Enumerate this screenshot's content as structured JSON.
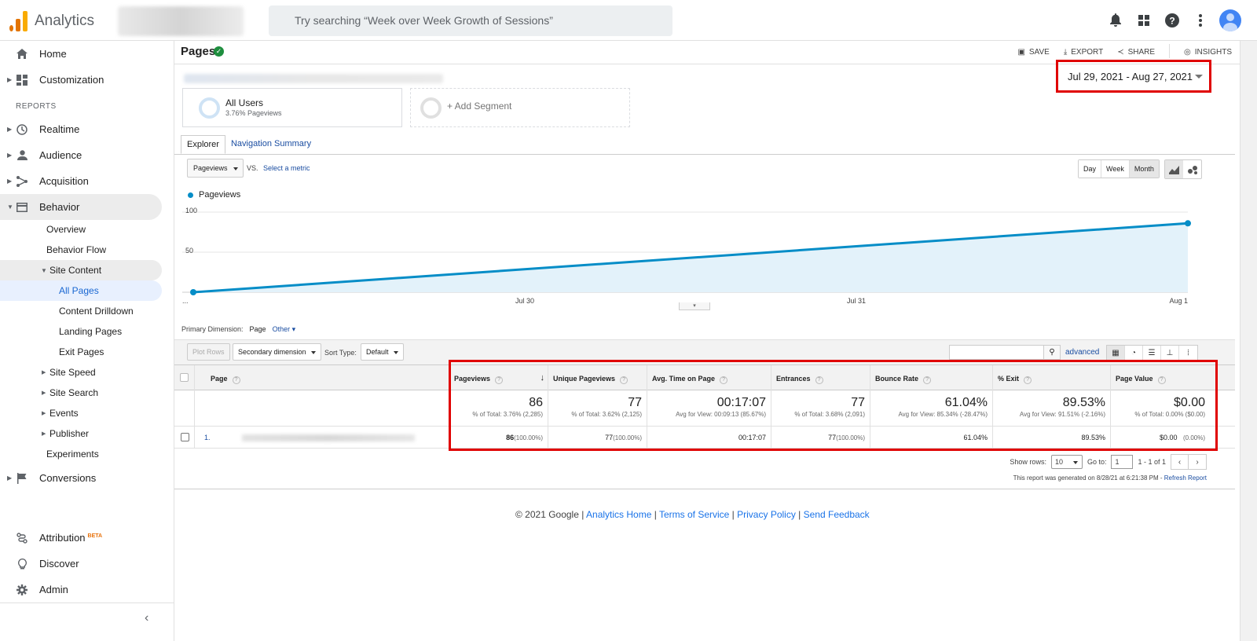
{
  "app": {
    "name": "Analytics"
  },
  "search": {
    "placeholder": "Try searching “Week over Week Growth of Sessions”"
  },
  "sidebar": {
    "home": "Home",
    "customization": "Customization",
    "reports_label": "REPORTS",
    "realtime": "Realtime",
    "audience": "Audience",
    "acquisition": "Acquisition",
    "behavior": "Behavior",
    "behavior_items": {
      "overview": "Overview",
      "behavior_flow": "Behavior Flow",
      "site_content": "Site Content",
      "all_pages": "All Pages",
      "content_drilldown": "Content Drilldown",
      "landing_pages": "Landing Pages",
      "exit_pages": "Exit Pages",
      "site_speed": "Site Speed",
      "site_search": "Site Search",
      "events": "Events",
      "publisher": "Publisher",
      "experiments": "Experiments"
    },
    "conversions": "Conversions",
    "attribution": "Attribution",
    "attribution_badge": "BETA",
    "discover": "Discover",
    "admin": "Admin"
  },
  "page": {
    "title": "Pages",
    "actions": {
      "save": "SAVE",
      "export": "EXPORT",
      "share": "SHARE",
      "insights": "INSIGHTS"
    },
    "date_range": "Jul 29, 2021 - Aug 27, 2021"
  },
  "segments": {
    "all_users": "All Users",
    "all_users_sub": "3.76% Pageviews",
    "add": "+ Add Segment"
  },
  "tabs": {
    "explorer": "Explorer",
    "nav_summary": "Navigation Summary"
  },
  "chart_controls": {
    "metric": "Pageviews",
    "vs": "VS.",
    "select_metric": "Select a metric",
    "granularity": [
      "Day",
      "Week",
      "Month"
    ],
    "selected_granularity": "Month"
  },
  "chart_data": {
    "type": "area",
    "series": [
      {
        "name": "Pageviews",
        "values": [
          0,
          86
        ]
      }
    ],
    "x": [
      "...",
      "Aug 1"
    ],
    "x_ticks": [
      "...",
      "Jul 30",
      "Jul 31",
      "Aug 1"
    ],
    "y_ticks": [
      "100",
      "50"
    ],
    "ylim": [
      0,
      100
    ],
    "color": "#058dc7",
    "fill": "#e3f2fa",
    "grid": true
  },
  "table_controls": {
    "primary_dim_label": "Primary Dimension:",
    "primary_dim": "Page",
    "other": "Other",
    "plot_rows": "Plot Rows",
    "secondary_dim": "Secondary dimension",
    "sort_type_label": "Sort Type:",
    "sort_type": "Default",
    "advanced": "advanced"
  },
  "table": {
    "headers": [
      "Page",
      "Pageviews",
      "Unique Pageviews",
      "Avg. Time on Page",
      "Entrances",
      "Bounce Rate",
      "% Exit",
      "Page Value"
    ],
    "totals": [
      {
        "value": "86",
        "sub": "% of Total: 3.76% (2,285)"
      },
      {
        "value": "77",
        "sub": "% of Total: 3.62% (2,125)"
      },
      {
        "value": "00:17:07",
        "sub": "Avg for View: 00:09:13 (85.67%)"
      },
      {
        "value": "77",
        "sub": "% of Total: 3.68% (2,091)"
      },
      {
        "value": "61.04%",
        "sub": "Avg for View: 85.34% (-28.47%)"
      },
      {
        "value": "89.53%",
        "sub": "Avg for View: 91.51% (-2.16%)"
      },
      {
        "value": "$0.00",
        "sub": "% of Total: 0.00% ($0.00)"
      }
    ],
    "rows": [
      {
        "num": "1.",
        "pageviews": "86",
        "pageviews_pct": "(100.00%)",
        "unique": "77",
        "unique_pct": "(100.00%)",
        "avg_time": "00:17:07",
        "entrances": "77",
        "entrances_pct": "(100.00%)",
        "bounce": "61.04%",
        "exit": "89.53%",
        "value": "$0.00",
        "value_pct": "(0.00%)"
      }
    ]
  },
  "pager": {
    "show_rows_label": "Show rows:",
    "show_rows": "10",
    "goto_label": "Go to:",
    "goto": "1",
    "range": "1 - 1 of 1"
  },
  "generated": {
    "text": "This report was generated on 8/28/21 at 6:21:38 PM - ",
    "refresh": "Refresh Report"
  },
  "footer": {
    "copyright": "© 2021 Google",
    "links": [
      "Analytics Home",
      "Terms of Service",
      "Privacy Policy",
      "Send Feedback"
    ]
  }
}
